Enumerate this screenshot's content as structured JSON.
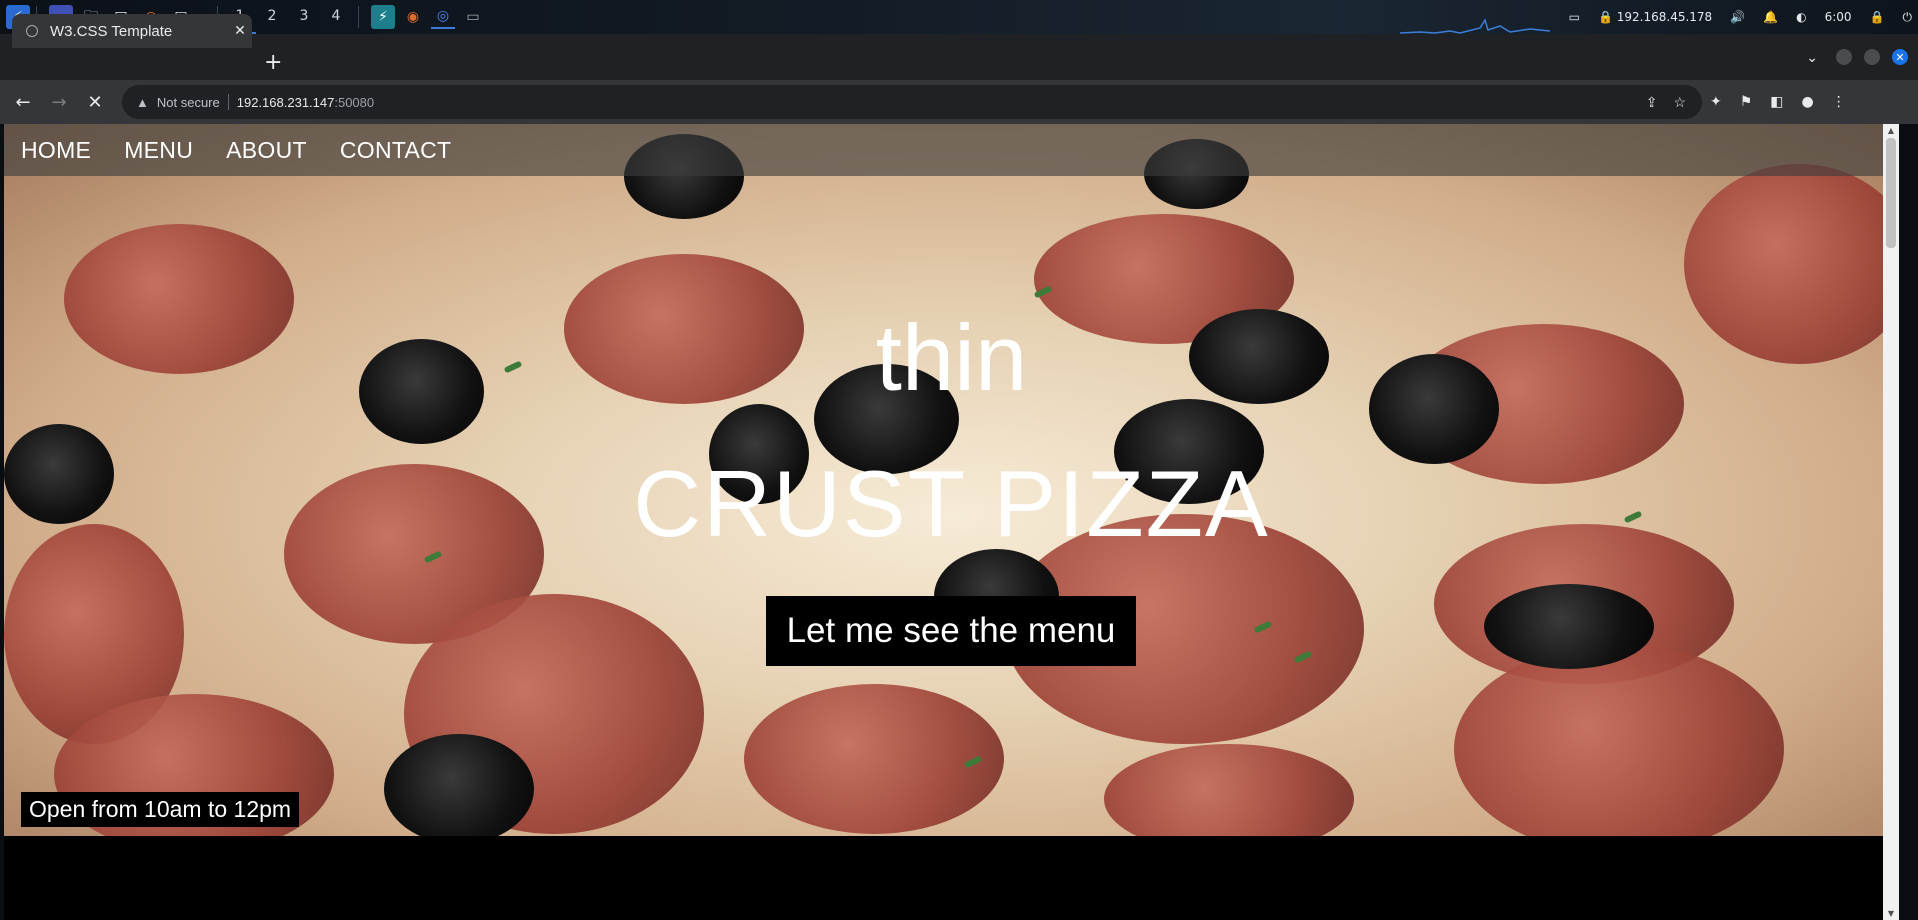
{
  "taskbar": {
    "workspaces": [
      "1",
      "2",
      "3",
      "4"
    ],
    "ip": "192.168.45.178",
    "time": "6:00"
  },
  "browser": {
    "tab_title": "W3.CSS Template",
    "not_secure": "Not secure",
    "url_host": "192.168.231.147",
    "url_port": ":50080"
  },
  "site": {
    "nav": [
      "HOME",
      "MENU",
      "ABOUT",
      "CONTACT"
    ],
    "hero_line1": "thin",
    "hero_line2": "CRUST PIZZA",
    "menu_button": "Let me see the menu",
    "hours": "Open from 10am to 12pm"
  }
}
